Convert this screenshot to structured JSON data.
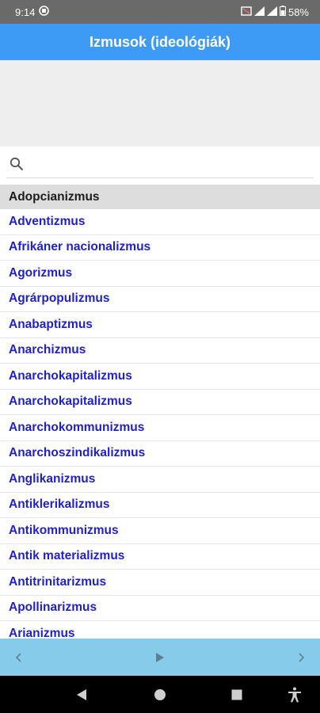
{
  "status_bar": {
    "time": "9:14",
    "battery": "58%"
  },
  "header": {
    "title": "Izmusok (ideológiák)"
  },
  "search": {
    "value": "",
    "placeholder": ""
  },
  "list": {
    "section_header": "Adopcianizmus",
    "items": [
      "Adventizmus",
      "Afrikáner nacionalizmus",
      "Agorizmus",
      "Agrárpopulizmus",
      "Anabaptizmus",
      "Anarchizmus",
      "Anarchokapitalizmus",
      "Anarchokapitalizmus",
      "Anarchokommunizmus",
      "Anarchoszindikalizmus",
      "Anglikanizmus",
      "Antiklerikalizmus",
      "Antikommunizmus",
      "Antik materializmus",
      "Antitrinitarizmus",
      "Apollinarizmus",
      "Arianizmus"
    ]
  },
  "icons": {
    "search": "search-icon",
    "prev": "chevron-left-icon",
    "play": "play-icon",
    "next": "chevron-right-icon"
  },
  "colors": {
    "title_bar": "#3e9bf5",
    "list_text": "#1f1fd0",
    "bottom_bar": "#86cbe9",
    "status_bar": "#6a6a6a"
  }
}
